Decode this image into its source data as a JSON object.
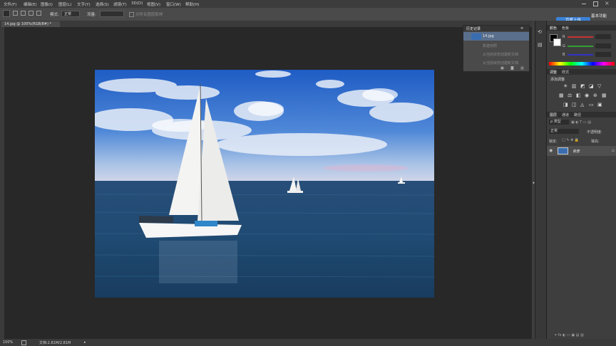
{
  "menu": {
    "items": [
      "文件(F)",
      "编辑(E)",
      "图像(I)",
      "图层(L)",
      "文字(Y)",
      "选择(S)",
      "滤镜(T)",
      "3D(D)",
      "视图(V)",
      "窗口(W)",
      "帮助(H)"
    ]
  },
  "options_bar": {
    "mode_label": "模式:",
    "mode_value": "正常",
    "opacity_label": "不透:",
    "opacity_value": "",
    "tolerance_label": "流量:",
    "tolerance_value": "",
    "align_label": "对所有图层取样",
    "baidu_button": "百度上传",
    "workspace_label": "基本功能"
  },
  "document": {
    "tab_title": "14.jpg @ 100%(RGB/8#) *",
    "zoom": "100%",
    "status": "文档:2.81M/2.81M"
  },
  "history": {
    "title": "历史记录",
    "snapshot": "14.jpg",
    "rows": [
      "新建快照",
      "从当前状态创建新文档",
      "从当前状态创建新文档"
    ]
  },
  "color_panel": {
    "tab_color": "颜色",
    "tab_swatches": "色板",
    "r": "R",
    "g": "G",
    "b": "B",
    "colors": {
      "r": "#c83232",
      "g": "#32a032",
      "b": "#3232c8"
    }
  },
  "adjustments": {
    "tab_adjust": "调整",
    "tab_styles": "样式",
    "add_label": "添加调整"
  },
  "layers": {
    "tab_layers": "图层",
    "tab_channels": "通道",
    "tab_paths": "路径",
    "kind_label": "ρ 类型",
    "blend_mode": "正常",
    "opacity_label": "不透明度:",
    "lock_label": "锁定:",
    "fill_label": "填充:",
    "layer_name": "背景"
  },
  "colors": {
    "accent": "#3b82d6",
    "panel_bg": "#3e3e3e",
    "canvas_bg": "#282828"
  }
}
